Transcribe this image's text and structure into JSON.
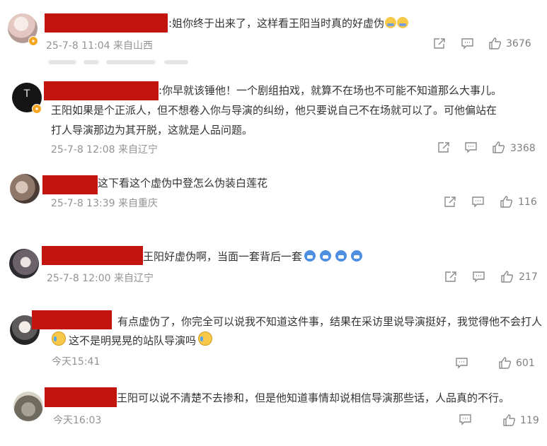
{
  "comments": [
    {
      "text": ":姐你终于出来了，这样看王阳当时真的好虚伪",
      "emojis": [
        "laugh",
        "laugh"
      ],
      "meta": "25-7-8 11:04 来自山西",
      "likes": "3676"
    },
    {
      "text_line1": ":你早就该锤他！一个剧组拍戏，就算不在场也不可能不知道那么大事儿。",
      "text_line2": "王阳如果是个正派人，但不想卷入你与导演的纠纷，他只要说自己不在场就可以了。可他偏站在",
      "text_line3": "打人导演那边为其开脱，这就是人品问题。",
      "meta": "25-7-8 12:08 来自辽宁",
      "likes": "3368"
    },
    {
      "text": "这下看这个虚伪中登怎么伪装白莲花",
      "meta": "25-7-8 13:39 来自重庆",
      "likes": "116"
    },
    {
      "text": "王阳好虚伪啊，当面一套背后一套",
      "emojis": [
        "shark",
        "shark",
        "shark",
        "shark"
      ],
      "meta": "25-7-8 12:00 来自辽宁",
      "likes": "217"
    },
    {
      "text_line1": "有点虚伪了，你完全可以说我不知道这件事，结果在采访里说导演挺好，我觉得他不会打人",
      "text_line2": "这不是明晃晃的站队导演吗",
      "emojis": [
        "cry",
        "cry"
      ],
      "meta": "今天15:41",
      "likes": "601"
    },
    {
      "text": "王阳可以说不清楚不去掺和，但是他知道事情却说相信导演那些话，人品真的不行。",
      "meta": "今天16:03",
      "likes": "119"
    }
  ],
  "icons": {
    "share": "share-icon",
    "comment": "comment-icon",
    "like": "thumbs-up-icon",
    "verified": "verified-badge-icon"
  },
  "colors": {
    "redaction": "#c3140f",
    "verified_badge": "#f5a623",
    "meta_text": "#939393"
  }
}
